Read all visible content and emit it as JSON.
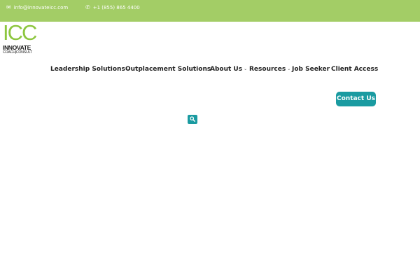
{
  "topbar": {
    "email": "info@innovateicc.com",
    "email_icon": "envelope-icon",
    "phone": "+1 (855) 865 4400",
    "phone_icon": "phone-icon",
    "background": "#a3cd66"
  },
  "logo": {
    "mark": "ICC",
    "line1": "INNOVATE",
    "line2": "COACH|CONSULT",
    "accent": "#8dc63f"
  },
  "nav": {
    "items": [
      {
        "label": "Leadership Solutions",
        "has_dropdown": true
      },
      {
        "label": "Outplacement Solutions",
        "has_dropdown": true
      },
      {
        "label": "About Us",
        "has_dropdown": true
      },
      {
        "label": "Resources",
        "has_dropdown": true
      },
      {
        "label": "Job Seeker",
        "has_dropdown": false
      },
      {
        "label": "Client Access",
        "has_dropdown": false
      }
    ],
    "caret": "⌄"
  },
  "cta": {
    "label": "Contact Us",
    "color": "#1a9ba1"
  },
  "search": {
    "icon": "search-icon"
  }
}
